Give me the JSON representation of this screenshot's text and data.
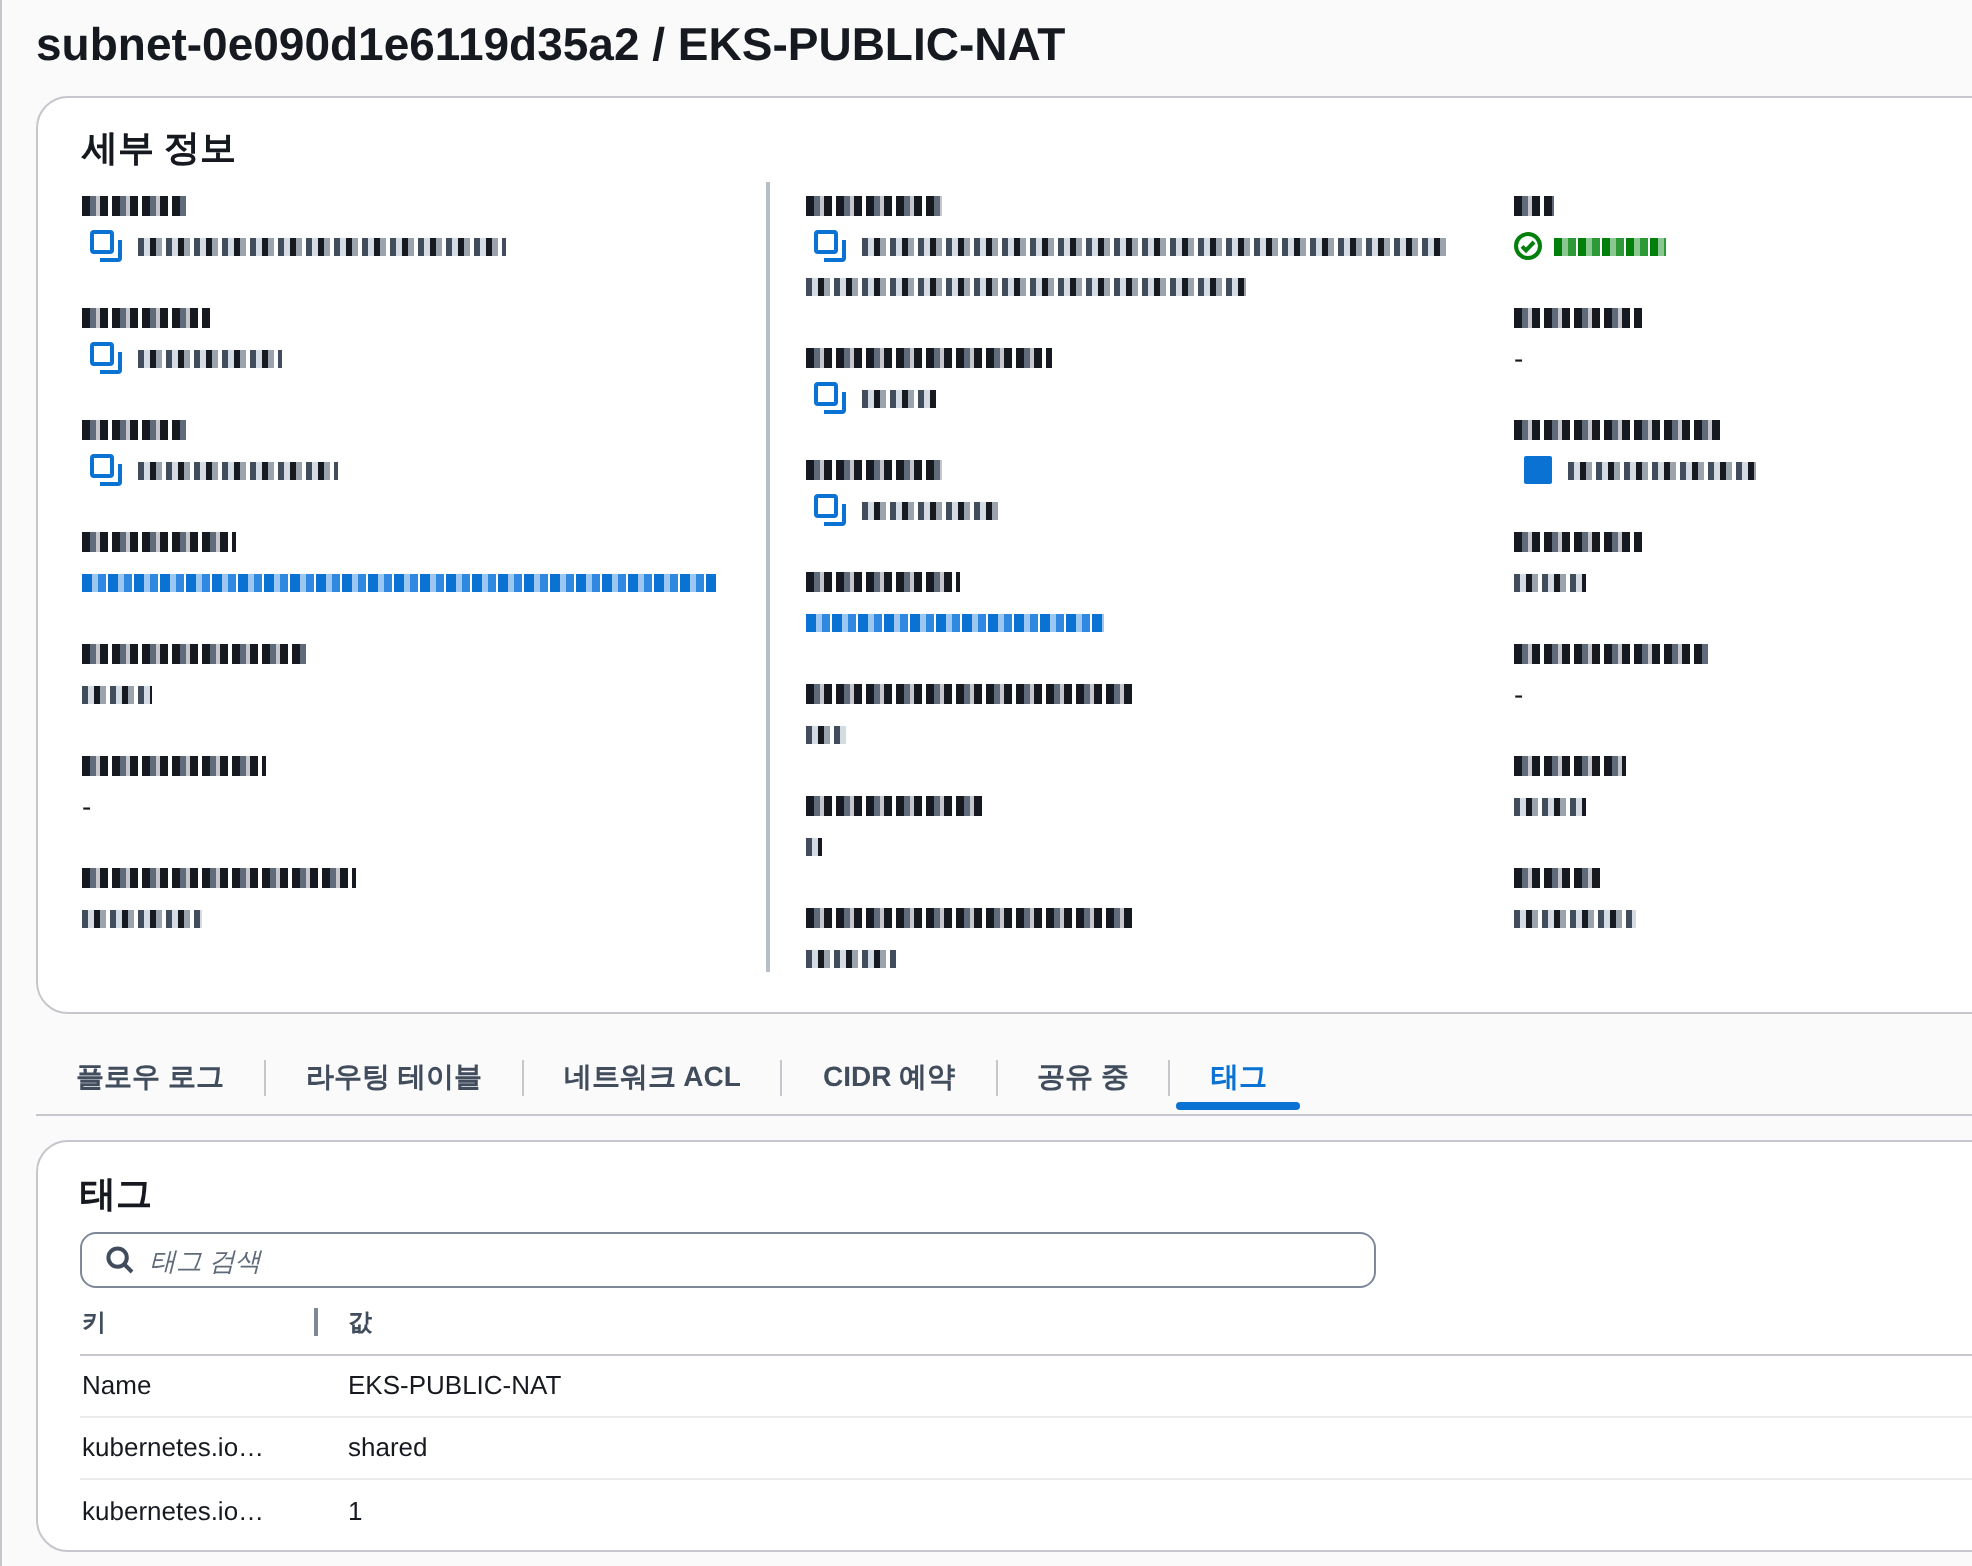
{
  "page_title": "subnet-0e090d1e6119d35a2 / EKS-PUBLIC-NAT",
  "details": {
    "title": "세부 정보",
    "columns": [
      [
        {
          "kind": "copy"
        },
        {
          "kind": "copy"
        },
        {
          "kind": "copy"
        },
        {
          "kind": "link"
        },
        {
          "kind": "pixelated"
        },
        {
          "kind": "text",
          "value": "-"
        },
        {
          "kind": "pixelated"
        }
      ],
      [
        {
          "kind": "copy_wrapped"
        },
        {
          "kind": "copy"
        },
        {
          "kind": "copy"
        },
        {
          "kind": "link"
        },
        {
          "kind": "pixelated"
        },
        {
          "kind": "pixelated"
        },
        {
          "kind": "pixelated"
        }
      ],
      [
        {
          "kind": "status"
        },
        {
          "kind": "text",
          "value": "-"
        },
        {
          "kind": "icon_link"
        },
        {
          "kind": "pixelated"
        },
        {
          "kind": "text",
          "value": "-"
        },
        {
          "kind": "pixelated"
        },
        {
          "kind": "pixelated"
        }
      ]
    ]
  },
  "tabs": [
    {
      "label": "플로우 로그",
      "selected": false
    },
    {
      "label": "라우팅 테이블",
      "selected": false
    },
    {
      "label": "네트워크 ACL",
      "selected": false
    },
    {
      "label": "CIDR 예약",
      "selected": false
    },
    {
      "label": "공유 중",
      "selected": false
    },
    {
      "label": "태그",
      "selected": true
    }
  ],
  "tags": {
    "title": "태그",
    "search": {
      "placeholder": "태그 검색"
    },
    "columns": [
      "키",
      "값"
    ],
    "rows": [
      {
        "key": "Name",
        "value": "EKS-PUBLIC-NAT"
      },
      {
        "key": "kubernetes.io…",
        "value": "shared"
      },
      {
        "key": "kubernetes.io…",
        "value": "1"
      }
    ]
  }
}
